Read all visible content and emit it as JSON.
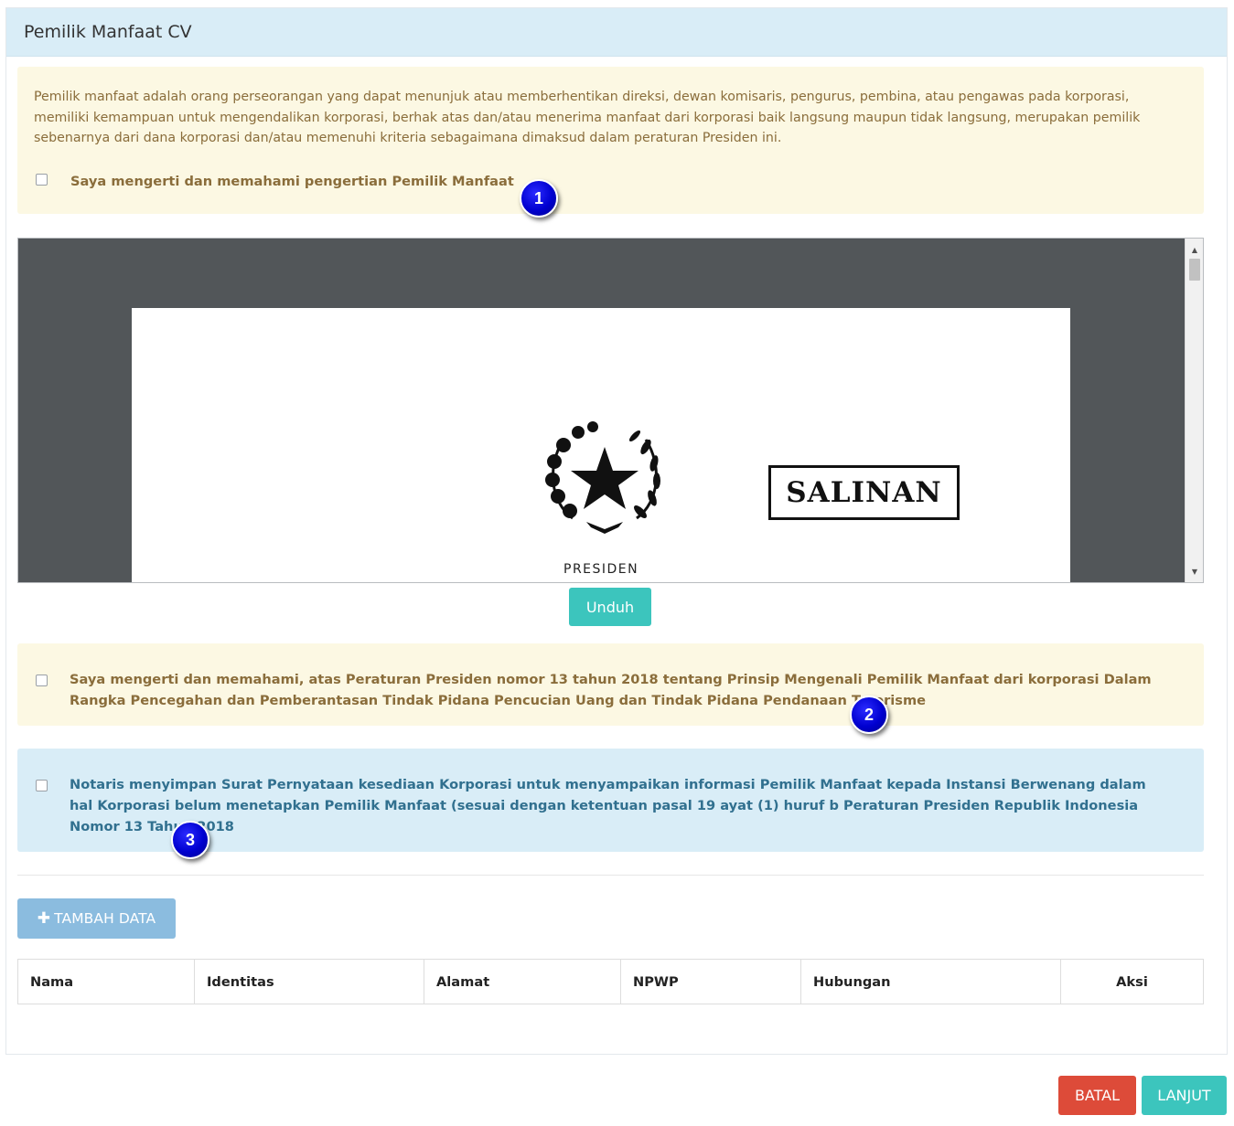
{
  "panel": {
    "title": "Pemilik Manfaat CV"
  },
  "definition": {
    "text": "Pemilik manfaat adalah orang perseorangan yang dapat menunjuk atau memberhentikan direksi, dewan komisaris, pengurus, pembina, atau pengawas pada korporasi, memiliki kemampuan untuk mengendalikan korporasi, berhak atas dan/atau menerima manfaat dari korporasi baik langsung maupun tidak langsung, merupakan pemilik sebenarnya dari dana korporasi dan/atau memenuhi kriteria sebagaimana dimaksud dalam peraturan Presiden ini.",
    "checkbox_label": "Saya mengerti dan memahami pengertian Pemilik Manfaat",
    "checked": false
  },
  "markers": [
    "1",
    "2",
    "3"
  ],
  "document_viewer": {
    "stamp_text": "SALINAN",
    "caption": "PRESIDEN",
    "emblem_icon": "garuda-star-emblem-icon"
  },
  "download_button": "Unduh",
  "agreement": {
    "checkbox_label": "Saya mengerti dan memahami, atas Peraturan Presiden nomor 13 tahun 2018 tentang Prinsip Mengenali Pemilik Manfaat dari korporasi Dalam Rangka Pencegahan dan Pemberantasan Tindak Pidana Pencucian Uang dan Tindak Pidana Pendanaan Terorisme",
    "checked": false
  },
  "notary": {
    "checkbox_label": "Notaris menyimpan Surat Pernyataan kesediaan Korporasi untuk menyampaikan informasi Pemilik Manfaat kepada Instansi Berwenang dalam hal Korporasi belum menetapkan Pemilik Manfaat (sesuai dengan ketentuan pasal 19 ayat (1) huruf b Peraturan Presiden Republik Indonesia Nomor 13 Tahun 2018",
    "checked": false
  },
  "add_button": {
    "icon": "plus-icon",
    "label": "TAMBAH DATA"
  },
  "table": {
    "columns": [
      "Nama",
      "Identitas",
      "Alamat",
      "NPWP",
      "Hubungan",
      "Aksi"
    ],
    "rows": []
  },
  "footer": {
    "cancel_label": "BATAL",
    "next_label": "LANJUT"
  },
  "colors": {
    "warning_bg": "#fcf8e3",
    "warning_text": "#8a6d3b",
    "info_bg": "#d9edf7",
    "info_text": "#31708f",
    "teal_button": "#3cc5bd",
    "red_button": "#dd4b39",
    "blue_button": "#8bbcdf",
    "marker": "#0000d0"
  }
}
